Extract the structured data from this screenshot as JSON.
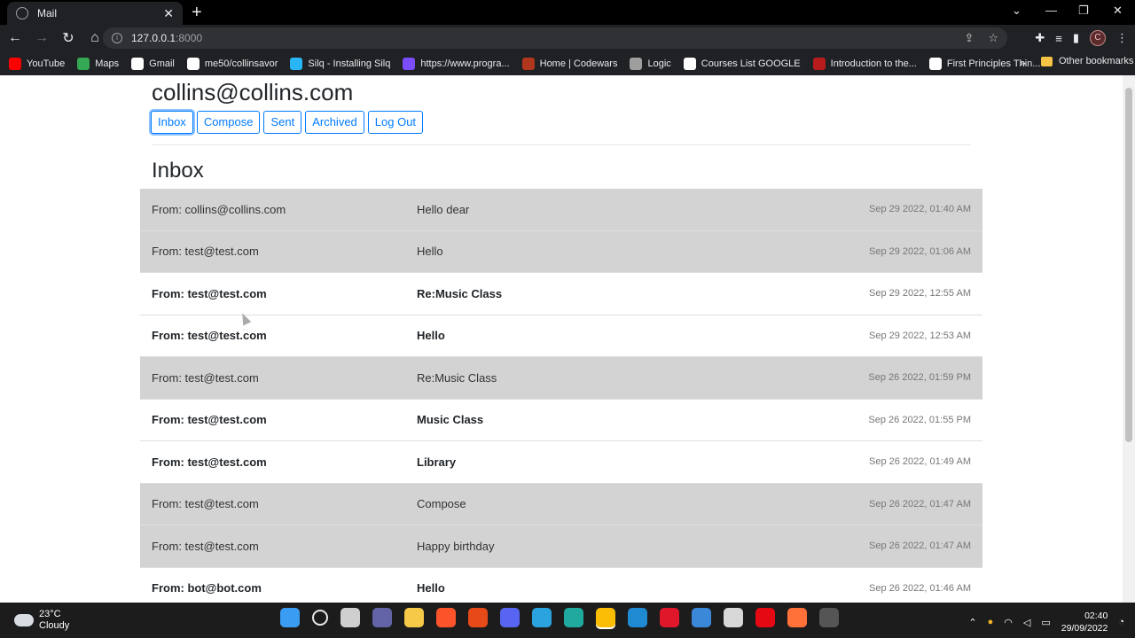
{
  "browser": {
    "tab_title": "Mail",
    "address_host": "127.0.0.1",
    "address_port": ":8000",
    "bookmarks": [
      {
        "label": "YouTube",
        "color": "#ff0000"
      },
      {
        "label": "Maps",
        "color": "#34a853"
      },
      {
        "label": "Gmail",
        "color": "#ffffff"
      },
      {
        "label": "me50/collinsavor",
        "color": "#ffffff"
      },
      {
        "label": "Silq - Installing Silq",
        "color": "#29b6f6"
      },
      {
        "label": "https://www.progra...",
        "color": "#7c4dff"
      },
      {
        "label": "Home | Codewars",
        "color": "#b1361e"
      },
      {
        "label": "Logic",
        "color": "#9e9e9e"
      },
      {
        "label": "Courses List GOOGLE",
        "color": "#ffffff"
      },
      {
        "label": "Introduction to the...",
        "color": "#b71c1c"
      },
      {
        "label": "First Principles Thin...",
        "color": "#ffffff"
      }
    ],
    "other_bookmarks": "Other bookmarks",
    "profile_initial": "C"
  },
  "app": {
    "user_email": "collins@collins.com",
    "nav": {
      "inbox": "Inbox",
      "compose": "Compose",
      "sent": "Sent",
      "archived": "Archived",
      "logout": "Log Out"
    },
    "mailbox_title": "Inbox"
  },
  "emails": [
    {
      "from": "From: collins@collins.com",
      "subject": "Hello dear",
      "timestamp": "Sep 29 2022, 01:40 AM",
      "read": true
    },
    {
      "from": "From: test@test.com",
      "subject": "Hello",
      "timestamp": "Sep 29 2022, 01:06 AM",
      "read": true
    },
    {
      "from": "From: test@test.com",
      "subject": "Re:Music Class",
      "timestamp": "Sep 29 2022, 12:55 AM",
      "read": false
    },
    {
      "from": "From: test@test.com",
      "subject": "Hello",
      "timestamp": "Sep 29 2022, 12:53 AM",
      "read": false
    },
    {
      "from": "From: test@test.com",
      "subject": "Re:Music Class",
      "timestamp": "Sep 26 2022, 01:59 PM",
      "read": true
    },
    {
      "from": "From: test@test.com",
      "subject": "Music Class",
      "timestamp": "Sep 26 2022, 01:55 PM",
      "read": false
    },
    {
      "from": "From: test@test.com",
      "subject": "Library",
      "timestamp": "Sep 26 2022, 01:49 AM",
      "read": false
    },
    {
      "from": "From: test@test.com",
      "subject": "Compose",
      "timestamp": "Sep 26 2022, 01:47 AM",
      "read": true
    },
    {
      "from": "From: test@test.com",
      "subject": "Happy birthday",
      "timestamp": "Sep 26 2022, 01:47 AM",
      "read": true
    },
    {
      "from": "From: bot@bot.com",
      "subject": "Hello",
      "timestamp": "Sep 26 2022, 01:46 AM",
      "read": false
    }
  ],
  "taskbar": {
    "temperature": "23°C",
    "weather": "Cloudy",
    "time": "02:40",
    "date": "29/09/2022",
    "apps": [
      {
        "name": "windows-start-icon",
        "color": "#3a9cf2"
      },
      {
        "name": "search-icon",
        "color": "#1c1c1c"
      },
      {
        "name": "file-explorer-icon",
        "color": "#cfcfcf"
      },
      {
        "name": "teams-chat-icon",
        "color": "#6264a7"
      },
      {
        "name": "folder-icon",
        "color": "#f7c948"
      },
      {
        "name": "brave-icon",
        "color": "#fb542b"
      },
      {
        "name": "office-icon",
        "color": "#e64a19"
      },
      {
        "name": "discord-icon",
        "color": "#5865f2"
      },
      {
        "name": "telegram-icon",
        "color": "#2aa3df"
      },
      {
        "name": "edge-icon",
        "color": "#20a99e"
      },
      {
        "name": "chrome-icon",
        "color": "#fbbc04"
      },
      {
        "name": "vscode-icon",
        "color": "#1f8ad2"
      },
      {
        "name": "opera-icon",
        "color": "#e0162b"
      },
      {
        "name": "mail-icon",
        "color": "#3b88d9"
      },
      {
        "name": "store-icon",
        "color": "#d8d8d8"
      },
      {
        "name": "netflix-icon",
        "color": "#e50914"
      },
      {
        "name": "firefox-icon",
        "color": "#ff7139"
      },
      {
        "name": "chatgpt-icon",
        "color": "#555555"
      }
    ]
  }
}
